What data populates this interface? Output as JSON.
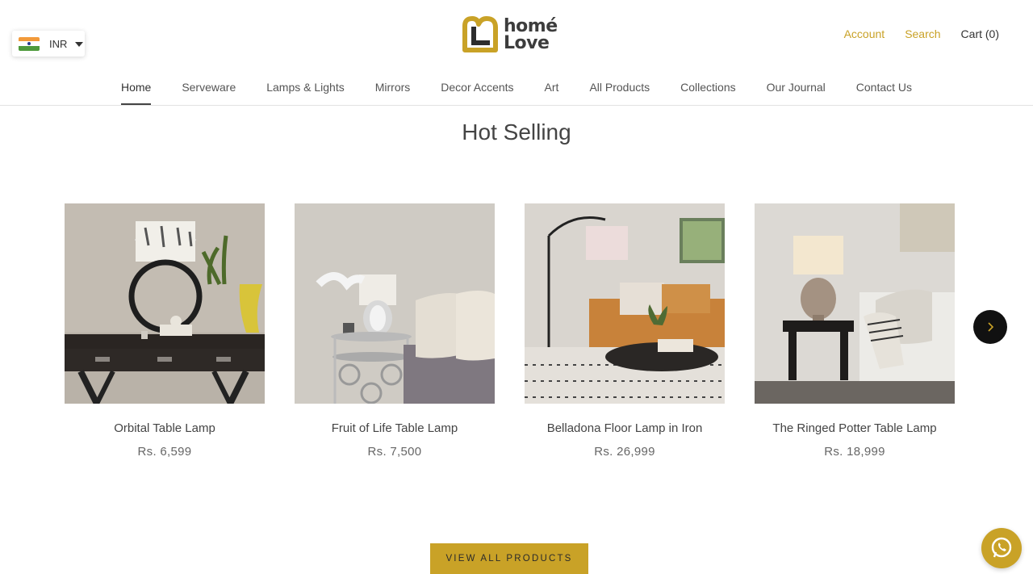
{
  "currency": {
    "code": "INR",
    "flag": "india-flag"
  },
  "logo": {
    "line1": "homé",
    "line2": "Love",
    "accent": "#c9a227"
  },
  "header": {
    "account": "Account",
    "search": "Search",
    "cart": "Cart (0)"
  },
  "nav": {
    "items": [
      {
        "label": "Home",
        "active": true
      },
      {
        "label": "Serveware"
      },
      {
        "label": "Lamps & Lights"
      },
      {
        "label": "Mirrors"
      },
      {
        "label": "Decor Accents"
      },
      {
        "label": "Art"
      },
      {
        "label": "All Products"
      },
      {
        "label": "Collections"
      },
      {
        "label": "Our Journal"
      },
      {
        "label": "Contact Us"
      }
    ]
  },
  "section": {
    "title": "Hot Selling"
  },
  "products": [
    {
      "name": "Orbital Table Lamp",
      "price": "Rs. 6,599"
    },
    {
      "name": "Fruit of Life Table Lamp",
      "price": "Rs. 7,500"
    },
    {
      "name": "Belladona Floor Lamp in Iron",
      "price": "Rs. 26,999"
    },
    {
      "name": "The Ringed Potter Table Lamp",
      "price": "Rs. 18,999"
    }
  ],
  "cta": {
    "label": "VIEW ALL PRODUCTS"
  },
  "colors": {
    "gold": "#c9a227",
    "text": "#444444",
    "arrow_bg": "#111111"
  },
  "icons": {
    "next": "chevron-right-icon",
    "chat": "whatsapp-icon"
  }
}
